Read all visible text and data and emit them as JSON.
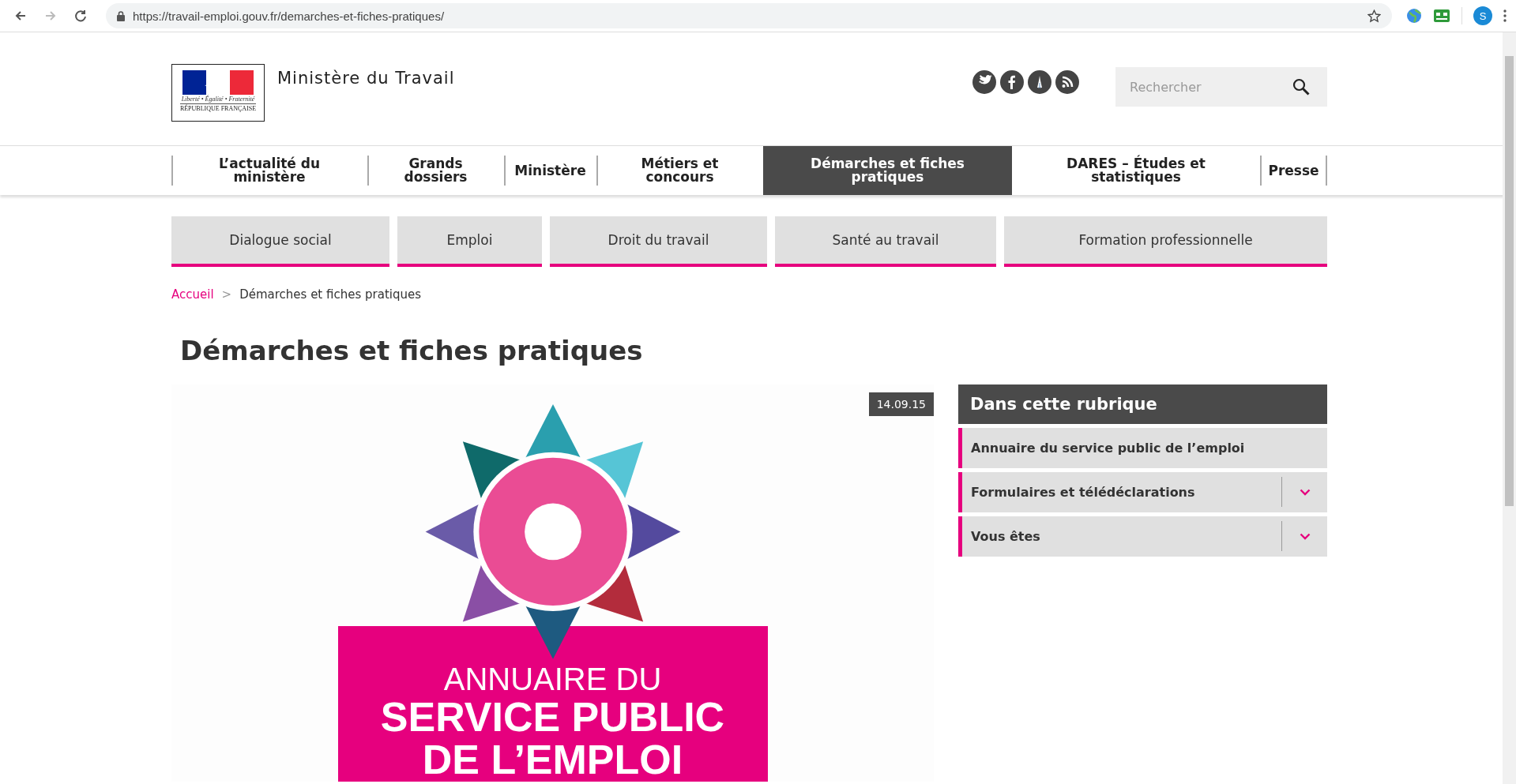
{
  "browser": {
    "nav_buttons": [
      {
        "kind": "back",
        "disabled": false
      },
      {
        "kind": "forward",
        "disabled": true
      },
      {
        "kind": "reload",
        "disabled": false
      }
    ],
    "url": "https://travail-emploi.gouv.fr/demarches-et-fiches-pratiques/",
    "profile_initial": "S"
  },
  "header": {
    "logo": {
      "motto": "Liberté • Égalité • Fraternité",
      "name": "RÉPUBLIQUE FRANÇAISE"
    },
    "site_title": "Ministère du Travail",
    "social": [
      {
        "kind": "bird"
      },
      {
        "kind": "f"
      },
      {
        "kind": "tower"
      },
      {
        "kind": "rss"
      }
    ],
    "search": {
      "placeholder": "Rechercher"
    }
  },
  "main_nav": [
    {
      "label": "L’actualité du ministère",
      "selected": false
    },
    {
      "label": "Grands dossiers",
      "selected": false
    },
    {
      "label": "Ministère",
      "selected": false
    },
    {
      "label": "Métiers et concours",
      "selected": false
    },
    {
      "label": "Démarches et fiches pratiques",
      "selected": true
    },
    {
      "label": "DARES – Études et statistiques",
      "selected": false
    },
    {
      "label": "Presse",
      "selected": false
    }
  ],
  "sub_nav": [
    {
      "label": "Dialogue social"
    },
    {
      "label": "Emploi"
    },
    {
      "label": "Droit du travail"
    },
    {
      "label": "Santé au travail"
    },
    {
      "label": "Formation professionnelle"
    }
  ],
  "breadcrumb": {
    "items": [
      {
        "label": "Accueil"
      },
      {
        "label": "Démarches et fiches pratiques"
      }
    ],
    "separator": ">"
  },
  "page_title": "Démarches et fiches pratiques",
  "article": {
    "date": "14.09.15",
    "banner_lines": [
      "ANNUAIRE DU",
      "SERVICE PUBLIC",
      "DE L’EMPLOI"
    ]
  },
  "sidebar": {
    "title": "Dans cette rubrique",
    "items": [
      {
        "label": "Annuaire du service public de l’emploi",
        "has_submenu": false
      },
      {
        "label": "Formulaires et télédéclarations",
        "has_submenu": true
      },
      {
        "label": "Vous êtes",
        "has_submenu": true
      }
    ]
  }
}
